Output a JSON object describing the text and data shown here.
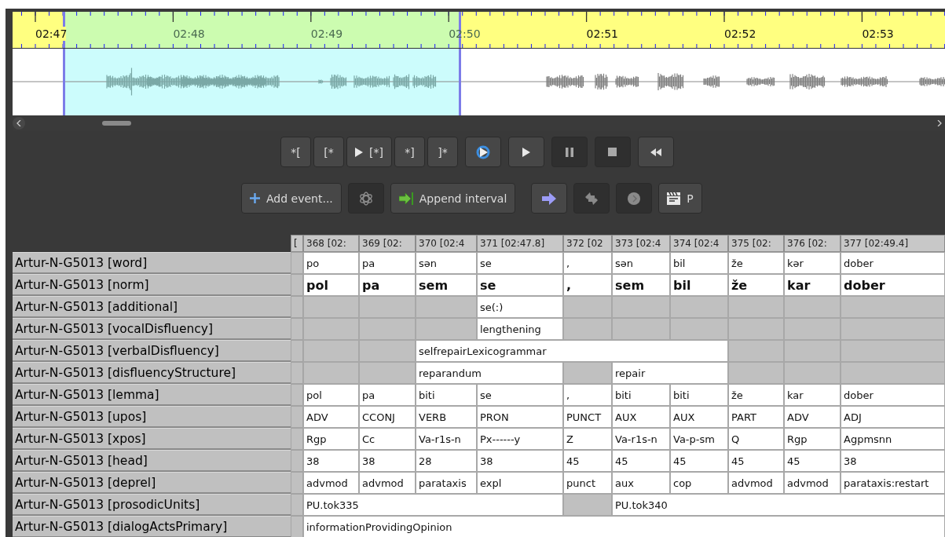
{
  "timeline": {
    "ticks": [
      "02:47",
      "02:48",
      "02:49",
      "02:50",
      "02:51",
      "02:52",
      "02:53"
    ]
  },
  "transport_buttons": [
    {
      "kind": "text",
      "label": "*[",
      "disabled": false
    },
    {
      "kind": "text",
      "label": "[*",
      "disabled": false
    },
    {
      "kind": "play-selection",
      "label": "[*]",
      "disabled": false
    },
    {
      "kind": "text",
      "label": "*]",
      "disabled": false
    },
    {
      "kind": "text",
      "label": "]*",
      "disabled": false
    },
    {
      "kind": "loop",
      "disabled": false
    },
    {
      "kind": "play",
      "disabled": false
    },
    {
      "kind": "pause",
      "disabled": true
    },
    {
      "kind": "stop",
      "disabled": true
    },
    {
      "kind": "rewind",
      "disabled": false
    }
  ],
  "edit_buttons": [
    {
      "kind": "add",
      "label": "Add event...",
      "disabled": false
    },
    {
      "kind": "knot",
      "disabled": true
    },
    {
      "kind": "append",
      "label": "Append interval",
      "disabled": false
    },
    {
      "kind": "arrow",
      "disabled": false
    },
    {
      "kind": "swap",
      "disabled": true
    },
    {
      "kind": "circle",
      "disabled": true
    },
    {
      "kind": "clapper",
      "label": "P",
      "disabled": false
    }
  ],
  "table": {
    "columns": [
      "[",
      "368 [02:",
      "369 [02:",
      "370 [02:4",
      "371 [02:47.8]",
      "372 [02",
      "373 [02:4",
      "374 [02:4",
      "375 [02:",
      "376 [02:",
      "377 [02:49.4]"
    ],
    "rows": [
      {
        "tier": "Artur-N-G5013 [word]",
        "emphasis": false,
        "cells": [
          {
            "kind": "empty"
          },
          {
            "kind": "text",
            "text": "po"
          },
          {
            "kind": "text",
            "text": "pa"
          },
          {
            "kind": "text",
            "text": "sən"
          },
          {
            "kind": "text",
            "text": "se"
          },
          {
            "kind": "text",
            "text": ","
          },
          {
            "kind": "text",
            "text": "sən"
          },
          {
            "kind": "text",
            "text": "bil"
          },
          {
            "kind": "text",
            "text": "že"
          },
          {
            "kind": "text",
            "text": "kər"
          },
          {
            "kind": "text",
            "text": "dober"
          }
        ]
      },
      {
        "tier": "Artur-N-G5013 [norm]",
        "emphasis": true,
        "cells": [
          {
            "kind": "empty"
          },
          {
            "kind": "text",
            "text": "pol"
          },
          {
            "kind": "text",
            "text": "pa"
          },
          {
            "kind": "text",
            "text": "sem"
          },
          {
            "kind": "text",
            "text": "se"
          },
          {
            "kind": "text",
            "text": ","
          },
          {
            "kind": "text",
            "text": "sem"
          },
          {
            "kind": "text",
            "text": "bil"
          },
          {
            "kind": "text",
            "text": "že"
          },
          {
            "kind": "text",
            "text": "kar"
          },
          {
            "kind": "text",
            "text": "dober"
          }
        ]
      },
      {
        "tier": "Artur-N-G5013 [additional]",
        "emphasis": false,
        "cells": [
          {
            "kind": "empty"
          },
          {
            "kind": "empty"
          },
          {
            "kind": "empty"
          },
          {
            "kind": "empty"
          },
          {
            "kind": "text",
            "text": "se(:)"
          },
          {
            "kind": "empty"
          },
          {
            "kind": "empty"
          },
          {
            "kind": "empty"
          },
          {
            "kind": "empty"
          },
          {
            "kind": "empty"
          },
          {
            "kind": "empty"
          }
        ]
      },
      {
        "tier": "Artur-N-G5013 [vocalDisfluency]",
        "emphasis": false,
        "cells": [
          {
            "kind": "empty"
          },
          {
            "kind": "empty"
          },
          {
            "kind": "empty"
          },
          {
            "kind": "empty"
          },
          {
            "kind": "text",
            "text": "lengthening"
          },
          {
            "kind": "empty"
          },
          {
            "kind": "empty"
          },
          {
            "kind": "empty"
          },
          {
            "kind": "empty"
          },
          {
            "kind": "empty"
          },
          {
            "kind": "empty"
          }
        ]
      },
      {
        "tier": "Artur-N-G5013 [verbalDisfluency]",
        "emphasis": false,
        "cells": [
          {
            "kind": "empty"
          },
          {
            "kind": "empty"
          },
          {
            "kind": "empty"
          },
          {
            "kind": "text",
            "text": "selfrepairLexicogrammar"
          },
          {
            "kind": "continued"
          },
          {
            "kind": "continued"
          },
          {
            "kind": "continued"
          },
          {
            "kind": "continued"
          },
          {
            "kind": "empty"
          },
          {
            "kind": "empty"
          },
          {
            "kind": "empty"
          }
        ]
      },
      {
        "tier": "Artur-N-G5013 [disfluencyStructure]",
        "emphasis": false,
        "cells": [
          {
            "kind": "empty"
          },
          {
            "kind": "empty"
          },
          {
            "kind": "empty"
          },
          {
            "kind": "text",
            "text": "reparandum"
          },
          {
            "kind": "continued"
          },
          {
            "kind": "empty"
          },
          {
            "kind": "text",
            "text": "repair"
          },
          {
            "kind": "continued"
          },
          {
            "kind": "empty"
          },
          {
            "kind": "empty"
          },
          {
            "kind": "empty"
          }
        ]
      },
      {
        "tier": "Artur-N-G5013 [lemma]",
        "emphasis": false,
        "cells": [
          {
            "kind": "empty"
          },
          {
            "kind": "text",
            "text": "pol"
          },
          {
            "kind": "text",
            "text": "pa"
          },
          {
            "kind": "text",
            "text": "biti"
          },
          {
            "kind": "text",
            "text": "se"
          },
          {
            "kind": "text",
            "text": ","
          },
          {
            "kind": "text",
            "text": "biti"
          },
          {
            "kind": "text",
            "text": "biti"
          },
          {
            "kind": "text",
            "text": "že"
          },
          {
            "kind": "text",
            "text": "kar"
          },
          {
            "kind": "text",
            "text": "dober"
          }
        ]
      },
      {
        "tier": "Artur-N-G5013 [upos]",
        "emphasis": false,
        "cells": [
          {
            "kind": "empty"
          },
          {
            "kind": "text",
            "text": "ADV"
          },
          {
            "kind": "text",
            "text": "CCONJ"
          },
          {
            "kind": "text",
            "text": "VERB"
          },
          {
            "kind": "text",
            "text": "PRON"
          },
          {
            "kind": "text",
            "text": "PUNCT"
          },
          {
            "kind": "text",
            "text": "AUX"
          },
          {
            "kind": "text",
            "text": "AUX"
          },
          {
            "kind": "text",
            "text": "PART"
          },
          {
            "kind": "text",
            "text": "ADV"
          },
          {
            "kind": "text",
            "text": "ADJ"
          }
        ]
      },
      {
        "tier": "Artur-N-G5013 [xpos]",
        "emphasis": false,
        "cells": [
          {
            "kind": "empty"
          },
          {
            "kind": "text",
            "text": "Rgp"
          },
          {
            "kind": "text",
            "text": "Cc"
          },
          {
            "kind": "text",
            "text": "Va-r1s-n"
          },
          {
            "kind": "text",
            "text": "Px------y"
          },
          {
            "kind": "text",
            "text": "Z"
          },
          {
            "kind": "text",
            "text": "Va-r1s-n"
          },
          {
            "kind": "text",
            "text": "Va-p-sm"
          },
          {
            "kind": "text",
            "text": "Q"
          },
          {
            "kind": "text",
            "text": "Rgp"
          },
          {
            "kind": "text",
            "text": "Agpmsnn"
          }
        ]
      },
      {
        "tier": "Artur-N-G5013 [head]",
        "emphasis": false,
        "cells": [
          {
            "kind": "empty"
          },
          {
            "kind": "text",
            "text": "38"
          },
          {
            "kind": "text",
            "text": "38"
          },
          {
            "kind": "text",
            "text": "28"
          },
          {
            "kind": "text",
            "text": "38"
          },
          {
            "kind": "text",
            "text": "45"
          },
          {
            "kind": "text",
            "text": "45"
          },
          {
            "kind": "text",
            "text": "45"
          },
          {
            "kind": "text",
            "text": "45"
          },
          {
            "kind": "text",
            "text": "45"
          },
          {
            "kind": "text",
            "text": "38"
          }
        ]
      },
      {
        "tier": "Artur-N-G5013 [deprel]",
        "emphasis": false,
        "cells": [
          {
            "kind": "empty"
          },
          {
            "kind": "text",
            "text": "advmod"
          },
          {
            "kind": "text",
            "text": "advmod"
          },
          {
            "kind": "text",
            "text": "parataxis"
          },
          {
            "kind": "text",
            "text": "expl"
          },
          {
            "kind": "text",
            "text": "punct"
          },
          {
            "kind": "text",
            "text": "aux"
          },
          {
            "kind": "text",
            "text": "cop"
          },
          {
            "kind": "text",
            "text": "advmod"
          },
          {
            "kind": "text",
            "text": "advmod"
          },
          {
            "kind": "text",
            "text": "parataxis:restart"
          }
        ]
      },
      {
        "tier": "Artur-N-G5013 [prosodicUnits]",
        "emphasis": false,
        "cells": [
          {
            "kind": "empty"
          },
          {
            "kind": "text",
            "text": "PU.tok335"
          },
          {
            "kind": "continued"
          },
          {
            "kind": "continued"
          },
          {
            "kind": "continued"
          },
          {
            "kind": "empty"
          },
          {
            "kind": "text",
            "text": "PU.tok340"
          },
          {
            "kind": "continued"
          },
          {
            "kind": "continued"
          },
          {
            "kind": "continued"
          },
          {
            "kind": "continued"
          }
        ]
      },
      {
        "tier": "Artur-N-G5013 [dialogActsPrimary]",
        "emphasis": false,
        "cells": [
          {
            "kind": "empty"
          },
          {
            "kind": "text",
            "text": "informationProvidingOpinion"
          },
          {
            "kind": "continued"
          },
          {
            "kind": "continued"
          },
          {
            "kind": "continued"
          },
          {
            "kind": "continued"
          },
          {
            "kind": "continued"
          },
          {
            "kind": "continued"
          },
          {
            "kind": "continued"
          },
          {
            "kind": "continued"
          },
          {
            "kind": "continued"
          }
        ]
      }
    ]
  }
}
